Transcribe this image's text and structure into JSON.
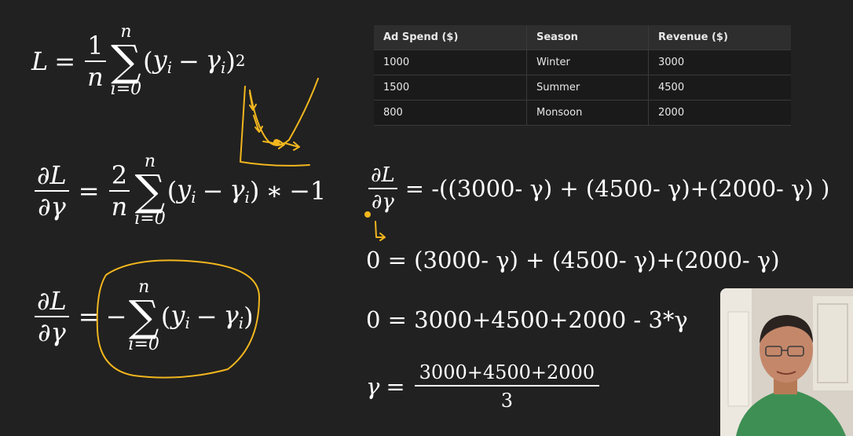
{
  "eq1": {
    "lhs": "L",
    "eq": "=",
    "coef_num": "1",
    "coef_den": "n",
    "sum_top": "n",
    "sum_bottom": "i=0",
    "paren_open": "(",
    "y": "y",
    "y_sub": "i",
    "minus": "−",
    "gamma": "γ",
    "g_sub": "i",
    "paren_close": ")",
    "exp": "2"
  },
  "eq2": {
    "d_num": "∂L",
    "d_den": "∂γ",
    "eq": "=",
    "coef_num": "2",
    "coef_den": "n",
    "sum_top": "n",
    "sum_bottom": "i=0",
    "paren_open": "(",
    "y": "y",
    "y_sub": "i",
    "minus": "−",
    "gamma": "γ",
    "g_sub": "i",
    "paren_close": ")",
    "times": "∗",
    "neg_one": "−1"
  },
  "eq3": {
    "d_num": "∂L",
    "d_den": "∂γ",
    "eq": "=",
    "neg": "−",
    "sum_top": "n",
    "sum_bottom": "i=0",
    "paren_open": "(",
    "y": "y",
    "y_sub": "i",
    "minus": "−",
    "gamma": "γ",
    "g_sub": "i",
    "paren_close": ")"
  },
  "table": {
    "headers": [
      "Ad Spend ($)",
      "Season",
      "Revenue ($)"
    ],
    "rows": [
      [
        "1000",
        "Winter",
        "3000"
      ],
      [
        "1500",
        "Summer",
        "4500"
      ],
      [
        "800",
        "Monsoon",
        "2000"
      ]
    ]
  },
  "eq4": {
    "d_num": "∂L",
    "d_den": "∂γ",
    "rhs": "= -((3000- γ) + (4500- γ)+(2000- γ) )"
  },
  "eq5": {
    "text": "0 = (3000- γ) + (4500- γ)+(2000- γ)"
  },
  "eq6": {
    "text": "0 = 3000+4500+2000 - 3*γ"
  },
  "eq7": {
    "lhs": "γ",
    "eq": "=",
    "num": "3000+4500+2000",
    "den": "3"
  },
  "annotation_color": "#f2b61e"
}
